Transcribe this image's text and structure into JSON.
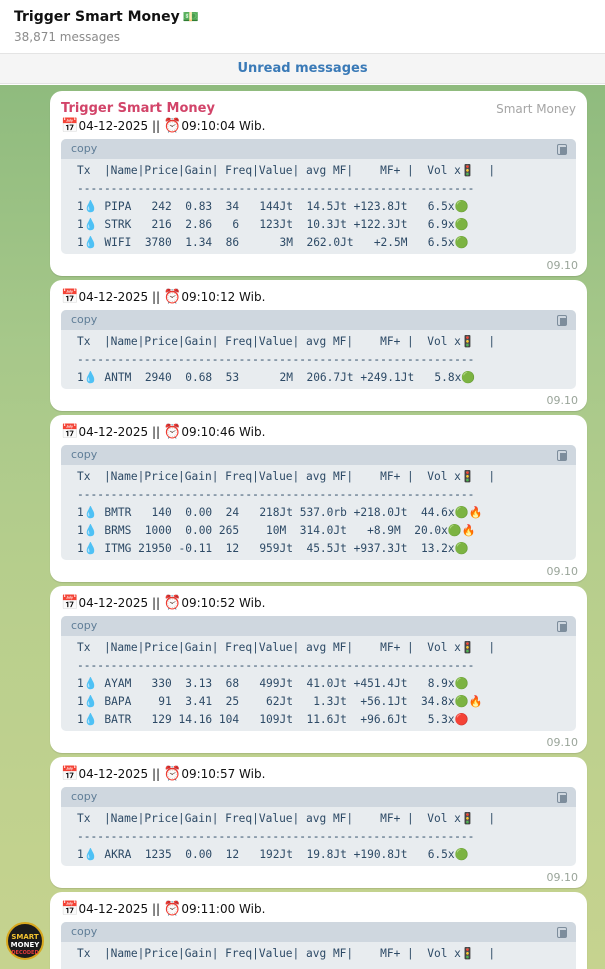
{
  "header": {
    "title": "Trigger Smart Money",
    "title_emoji": "💵",
    "subtitle": "38,871 messages"
  },
  "unread_label": "Unread messages",
  "channel": {
    "sender": "Trigger Smart Money",
    "badge": "Smart Money"
  },
  "avatar": {
    "line1": "SMART",
    "line2": "MONEY",
    "line3": "DECODED"
  },
  "code_label": "copy",
  "table_header": "Tx  |Name|Price|Gain| Freq|Value| avg MF|    MF+ |  Vol x🚦  |",
  "table_divider": "-----------------------------------------------------------",
  "messages": [
    {
      "date": "04-12-2025",
      "sep": " || ",
      "clock_time": "09:10:04 Wib.",
      "time": "09.10",
      "rows": [
        "1💧 PIPA   242  0.83  34   144Jt  14.5Jt +123.8Jt   6.5x🟢",
        "1💧 STRK   216  2.86   6   123Jt  10.3Jt +122.3Jt   6.9x🟢",
        "1💧 WIFI  3780  1.34  86      3M  262.0Jt   +2.5M   6.5x🟢"
      ]
    },
    {
      "date": "04-12-2025",
      "sep": " || ",
      "clock_time": "09:10:12 Wib.",
      "time": "09.10",
      "rows": [
        "1💧 ANTM  2940  0.68  53      2M  206.7Jt +249.1Jt   5.8x🟢"
      ]
    },
    {
      "date": "04-12-2025",
      "sep": " || ",
      "clock_time": "09:10:46 Wib.",
      "time": "09.10",
      "rows": [
        "1💧 BMTR   140  0.00  24   218Jt 537.0rb +218.0Jt  44.6x🟢🔥",
        "1💧 BRMS  1000  0.00 265    10M  314.0Jt   +8.9M  20.0x🟢🔥",
        "1💧 ITMG 21950 -0.11  12   959Jt  45.5Jt +937.3Jt  13.2x🟢"
      ]
    },
    {
      "date": "04-12-2025",
      "sep": " || ",
      "clock_time": "09:10:52 Wib.",
      "time": "09.10",
      "rows": [
        "1💧 AYAM   330  3.13  68   499Jt  41.0Jt +451.4Jt   8.9x🟢",
        "1💧 BAPA    91  3.41  25    62Jt   1.3Jt  +56.1Jt  34.8x🟢🔥",
        "1💧 BATR   129 14.16 104   109Jt  11.6Jt  +96.6Jt   5.3x🔴"
      ]
    },
    {
      "date": "04-12-2025",
      "sep": " || ",
      "clock_time": "09:10:57 Wib.",
      "time": "09.10",
      "rows": [
        "1💧 AKRA  1235  0.00  12   192Jt  19.8Jt +190.8Jt   6.5x🟢"
      ]
    },
    {
      "date": "04-12-2025",
      "sep": " || ",
      "clock_time": "09:11:00 Wib.",
      "time": "",
      "rows": []
    }
  ]
}
